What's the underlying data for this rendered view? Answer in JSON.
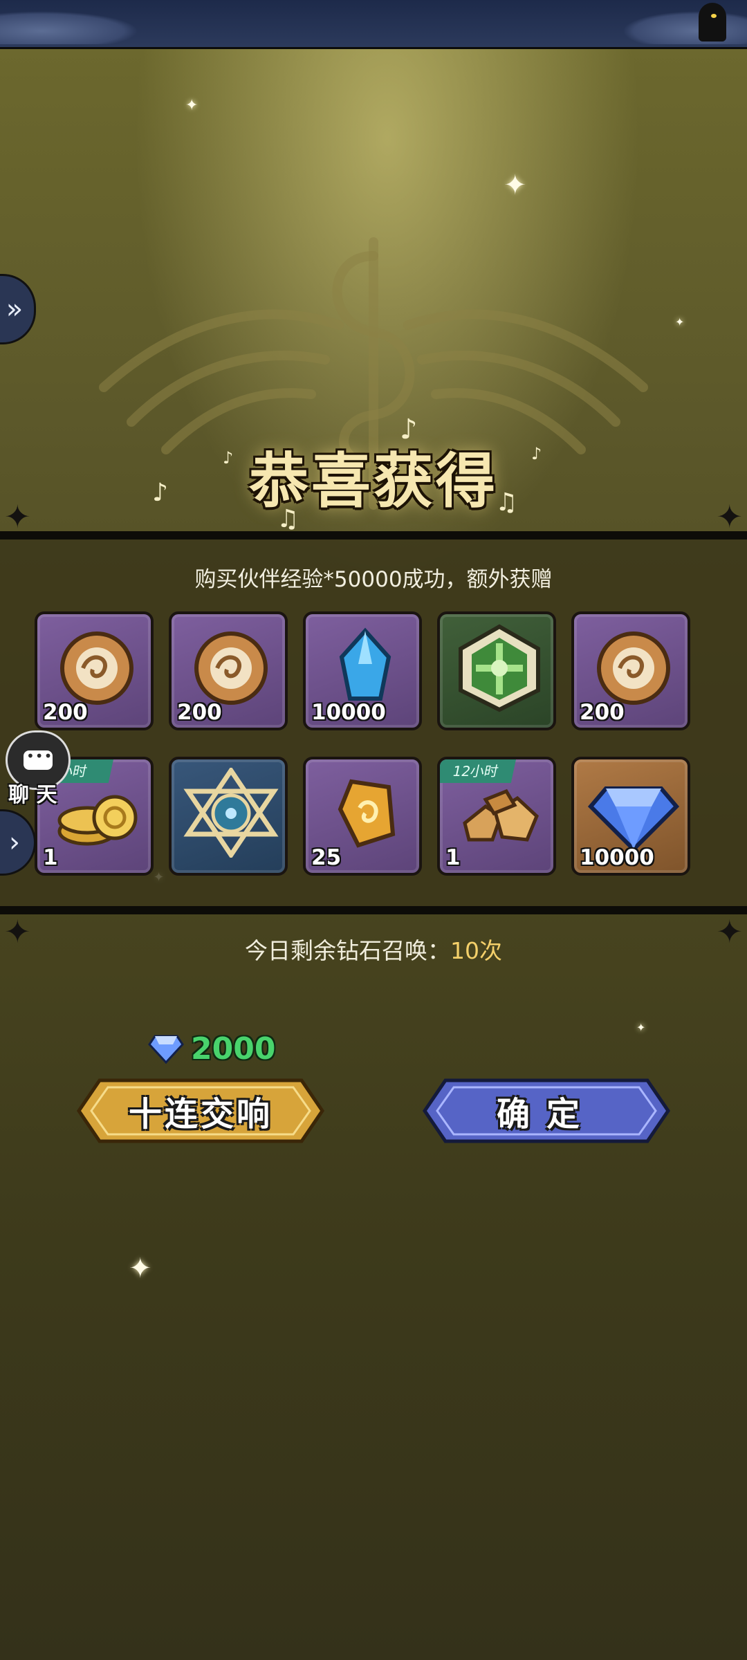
{
  "title": "恭喜获得",
  "reward_message": "购买伙伴经验*50000成功，额外获赠",
  "items": [
    {
      "type": "partner-exp-orb",
      "quantity": "200",
      "frame": "purple",
      "tag": ""
    },
    {
      "type": "partner-exp-orb",
      "quantity": "200",
      "frame": "purple",
      "tag": ""
    },
    {
      "type": "blue-crystal",
      "quantity": "10000",
      "frame": "purple",
      "tag": ""
    },
    {
      "type": "green-emblem",
      "quantity": "",
      "frame": "green",
      "tag": ""
    },
    {
      "type": "partner-exp-orb",
      "quantity": "200",
      "frame": "purple",
      "tag": ""
    },
    {
      "type": "gold-coins",
      "quantity": "1",
      "frame": "purple",
      "tag": "小时"
    },
    {
      "type": "blue-star-emblem",
      "quantity": "",
      "frame": "blue",
      "tag": ""
    },
    {
      "type": "gold-rune-stone",
      "quantity": "25",
      "frame": "purple",
      "tag": ""
    },
    {
      "type": "gold-ore",
      "quantity": "1",
      "frame": "purple",
      "tag": "12小时"
    },
    {
      "type": "diamond",
      "quantity": "10000",
      "frame": "orange",
      "tag": ""
    }
  ],
  "chat": {
    "label": "聊 天"
  },
  "remaining_summons": {
    "label": "今日剩余钻石召唤：",
    "count": "10次"
  },
  "cost": {
    "amount": "2000",
    "currency_icon": "diamond-icon"
  },
  "buttons": {
    "ten_summon": "十连交响",
    "confirm": "确定"
  },
  "colors": {
    "accent_gold": "#f4d06a",
    "cost_green": "#49d36c",
    "button_gold": "#d7a43a",
    "button_blue": "#5664c6"
  }
}
